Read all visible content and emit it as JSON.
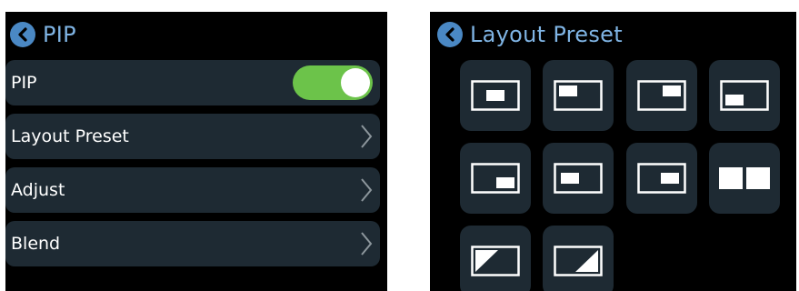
{
  "pip_screen": {
    "title": "PIP",
    "back_icon": "chevron-left-icon",
    "items": [
      {
        "label": "PIP",
        "control": "toggle",
        "state": "on"
      },
      {
        "label": "Layout Preset",
        "control": "chevron-right-icon"
      },
      {
        "label": "Adjust",
        "control": "chevron-right-icon"
      },
      {
        "label": "Blend",
        "control": "chevron-right-icon"
      }
    ]
  },
  "layout_screen": {
    "title": "Layout Preset",
    "back_icon": "chevron-left-icon",
    "presets": [
      "pip-center-icon",
      "pip-top-left-icon",
      "pip-top-right-icon",
      "pip-bottom-left-icon",
      "pip-bottom-right-icon",
      "pip-center-left-icon",
      "pip-center-right-icon",
      "side-by-side-icon",
      "blend-diagonal-left-icon",
      "blend-diagonal-right-icon"
    ]
  },
  "colors": {
    "background": "#000000",
    "item_bg": "#1e2a33",
    "accent": "#4a88c4",
    "title": "#7fb4e4",
    "toggle_on": "#6cc34a"
  }
}
